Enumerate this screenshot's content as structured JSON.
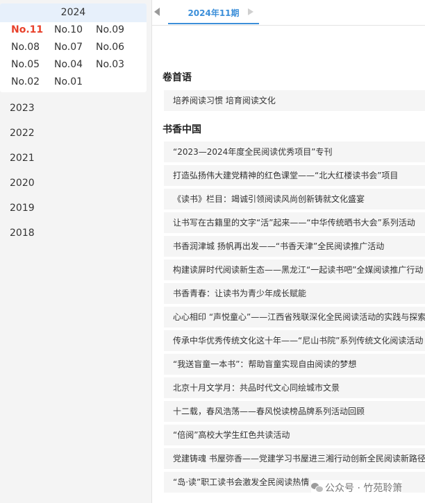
{
  "sidebar": {
    "current_year": "2024",
    "issues": [
      "No.11",
      "No.10",
      "No.09",
      "No.08",
      "No.07",
      "No.06",
      "No.05",
      "No.04",
      "No.03",
      "No.02",
      "No.01"
    ],
    "active_issue": "No.11",
    "years": [
      "2023",
      "2022",
      "2021",
      "2020",
      "2019",
      "2018"
    ]
  },
  "tabs": {
    "active_label": "2024年11期"
  },
  "content": {
    "sections": [
      {
        "title": "卷首语",
        "articles": [
          "培养阅读习惯 培育阅读文化"
        ]
      },
      {
        "title": "书香中国",
        "articles": [
          "“2023—2024年度全民阅读优秀项目”专刊",
          "打造弘扬伟大建党精神的红色课堂——“北大红楼读书会”项目",
          "《读书》栏目：竭诚引领阅读风尚创新铸就文化盛宴",
          "让书写在古籍里的文字“活”起来——“中华传统晒书大会”系列活动",
          "书香润津城 扬帆再出发——“书香天津”全民阅读推广活动",
          "构建读屏时代阅读新生态——黑龙江“一起读书吧”全媒阅读推广行动",
          "书香青春：让读书为青少年成长赋能",
          "心心相印 “声悦童心”——江西省残联深化全民阅读活动的实践与探索",
          "传承中华优秀传统文化这十年——“尼山书院”系列传统文化阅读活动",
          "“我送盲童一本书”：帮助盲童实现自由阅读的梦想",
          "北京十月文学月：共品时代文心同绘城市文景",
          "十二载，春风浩荡——春风悦读榜品牌系列活动回顾",
          "“倍阅”高校大学生红色共读活动",
          "党建铸魂 书屋弥香——党建学习书屋进三湘行动创新全民阅读新路径",
          "“岛·读”职工读书会激发全民阅读热情"
        ]
      }
    ]
  },
  "watermark": {
    "label": "公众号 · 竹苑聆箫",
    "icon": "wechat-icon"
  }
}
